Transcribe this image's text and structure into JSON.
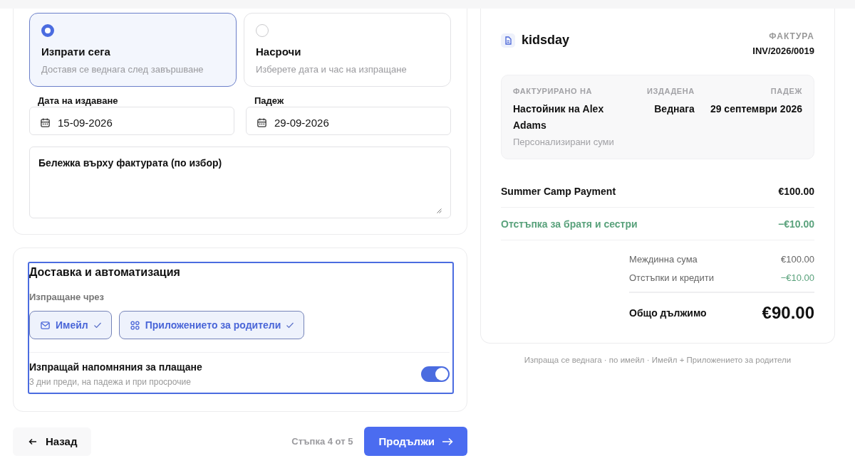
{
  "send_options": [
    {
      "title": "Изпрати сега",
      "description": "Доставя се веднага след завършване",
      "selected": true
    },
    {
      "title": "Насрочи",
      "description": "Изберете дата и час на изпращане",
      "selected": false
    }
  ],
  "date_fields": [
    {
      "label": "Дата на издаване",
      "value": "15-09-2026"
    },
    {
      "label": "Падеж",
      "value": "29-09-2026"
    }
  ],
  "note_field": {
    "label": "Бележка върху фактурата (по избор)"
  },
  "delivery": {
    "title": "Доставка и автоматизация",
    "channels_label": "Изпращане чрез",
    "channels": [
      {
        "label": "Имейл",
        "kind": "mail",
        "selected": true
      },
      {
        "label": "Приложението за родители",
        "kind": "apps",
        "selected": true
      }
    ],
    "reminders": {
      "title": "Изпращай напомняния за плащане",
      "description": "3 дни преди, на падежа и при просрочие",
      "on": true
    }
  },
  "footer": {
    "back": "Назад",
    "step": "Стъпка 4 от 5",
    "next": "Продължи"
  },
  "invoice": {
    "brand": "kidsday",
    "doc_label": "ФАКТУРА",
    "number": "INV/2026/0019",
    "meta": {
      "billed_to_label": "ФАКТУРИРАНО НА",
      "billed_to": "Настойник на Alex Adams",
      "billed_note": "Персонализирани суми",
      "issued_label": "ИЗДАДЕНА",
      "issued": "Веднага",
      "due_label": "ПАДЕЖ",
      "due": "29 септември 2026"
    },
    "lines": [
      {
        "kind": "charge",
        "label": "Summer Camp Payment",
        "amount": "€100.00"
      },
      {
        "kind": "discount",
        "label": "Отстъпка за братя и сестри",
        "amount": "−€10.00"
      }
    ],
    "totals": [
      {
        "kind": "charge",
        "label": "Междинна сума",
        "amount": "€100.00"
      },
      {
        "kind": "discount",
        "label": "Отстъпки и кредити",
        "amount": "−€10.00"
      }
    ],
    "total": {
      "label": "Общо дължимо",
      "amount": "€90.00"
    }
  },
  "summary_note": "Изпраща се веднага · по имейл · Имейл + Приложението за родители"
}
